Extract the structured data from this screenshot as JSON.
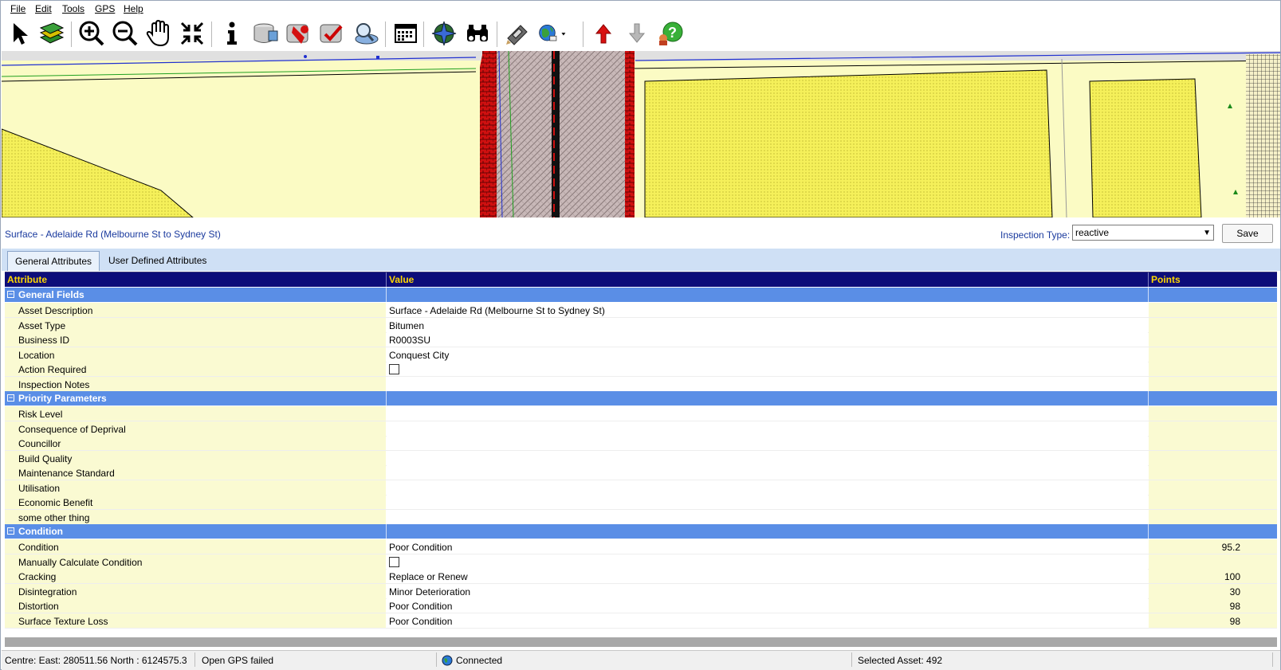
{
  "menu": [
    "File",
    "Edit",
    "Tools",
    "GPS",
    "Help"
  ],
  "toolbar_icons": [
    "select-arrow-icon",
    "layers-icon",
    "zoom-in-icon",
    "zoom-out-icon",
    "pan-hand-icon",
    "zoom-extent-icon",
    "info-icon",
    "asset-database-icon",
    "defect-icon",
    "inspection-icon",
    "search-map-icon",
    "calendar-icon",
    "globe-compass-icon",
    "binoculars-icon",
    "gps-satellite-icon",
    "web-globe-icon",
    "upload-red-arrow-icon",
    "download-grey-arrow-icon",
    "help-icon"
  ],
  "asset": {
    "title": "Surface - Adelaide Rd (Melbourne St to Sydney St)",
    "inspection_type_label": "Inspection Type:",
    "inspection_type_value": "reactive",
    "save_label": "Save"
  },
  "tabs": [
    "General Attributes",
    "User Defined Attributes"
  ],
  "grid": {
    "headers": [
      "Attribute",
      "Value",
      "Points"
    ],
    "groups": [
      {
        "name": "General Fields",
        "rows": [
          {
            "attr": "Asset Description",
            "value": "Surface - Adelaide Rd (Melbourne St to Sydney St)",
            "points": ""
          },
          {
            "attr": "Asset Type",
            "value": "Bitumen",
            "points": ""
          },
          {
            "attr": "Business ID",
            "value": "R0003SU",
            "points": ""
          },
          {
            "attr": "Location",
            "value": "Conquest City",
            "points": ""
          },
          {
            "attr": "Action Required",
            "value": "",
            "points": "",
            "checkbox": true
          },
          {
            "attr": "Inspection Notes",
            "value": "",
            "points": ""
          }
        ]
      },
      {
        "name": "Priority Parameters",
        "rows": [
          {
            "attr": "Risk Level",
            "value": "",
            "points": ""
          },
          {
            "attr": "Consequence of Deprival",
            "value": "",
            "points": ""
          },
          {
            "attr": "Councillor",
            "value": "",
            "points": ""
          },
          {
            "attr": "Build Quality",
            "value": "",
            "points": ""
          },
          {
            "attr": "Maintenance Standard",
            "value": "",
            "points": ""
          },
          {
            "attr": "Utilisation",
            "value": "",
            "points": ""
          },
          {
            "attr": "Economic Benefit",
            "value": "",
            "points": ""
          },
          {
            "attr": "some other thing",
            "value": "",
            "points": ""
          }
        ]
      },
      {
        "name": "Condition",
        "rows": [
          {
            "attr": "Condition",
            "value": "Poor Condition",
            "points": "95.2"
          },
          {
            "attr": "Manually Calculate Condition",
            "value": "",
            "points": "",
            "checkbox": true
          },
          {
            "attr": "Cracking",
            "value": "Replace or Renew",
            "points": "100"
          },
          {
            "attr": "Disintegration",
            "value": "Minor Deterioration",
            "points": "30"
          },
          {
            "attr": "Distortion",
            "value": "Poor Condition",
            "points": "98"
          },
          {
            "attr": "Surface Texture Loss",
            "value": "Poor Condition",
            "points": "98"
          }
        ]
      }
    ]
  },
  "status": {
    "centre": "Centre:  East:  280511.56   North  : 6124575.3",
    "gps": "Open GPS failed",
    "connection": "Connected",
    "selected": "Selected Asset: 492"
  },
  "colors": {
    "grid_header_bg": "#0d0d7a",
    "grid_header_text": "#ffd700",
    "group_bg": "#5a8ee6",
    "attr_col_bg": "#fafad2",
    "title_text": "#1a3a9e",
    "map_land": "#fbfbc4",
    "map_block": "#f7f25a"
  }
}
